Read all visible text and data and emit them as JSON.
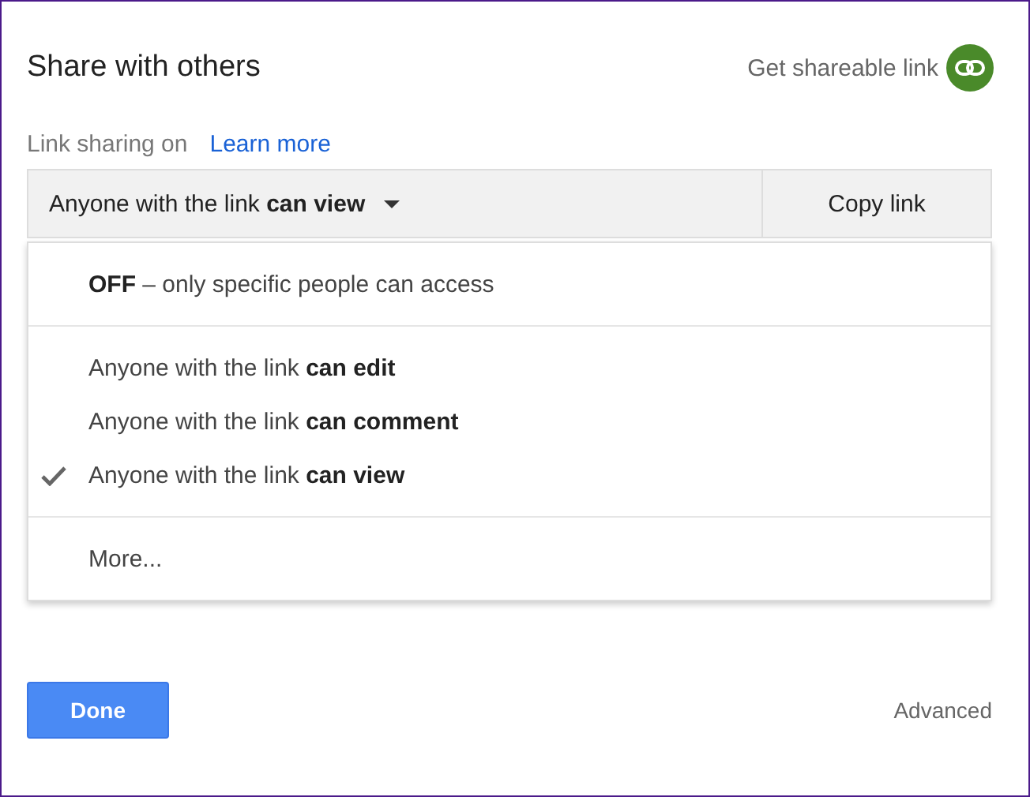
{
  "title": "Share with others",
  "get_link": {
    "label": "Get shareable link"
  },
  "link_sharing": {
    "status": "Link sharing on",
    "learn_more": "Learn more"
  },
  "access_dropdown": {
    "value": "Anyone with the link **can view**"
  },
  "copy_button": "Copy link",
  "menu_sections": [
    [
      {
        "text": "**OFF** – only specific people can access",
        "selected": false
      }
    ],
    [
      {
        "text": "Anyone with the link **can edit**",
        "selected": false
      },
      {
        "text": "Anyone with the link **can comment**",
        "selected": false
      },
      {
        "text": "Anyone with the link **can view**",
        "selected": true
      }
    ],
    [
      {
        "text": "More...",
        "selected": false
      }
    ]
  ],
  "done_button": "Done",
  "advanced_link": "Advanced"
}
